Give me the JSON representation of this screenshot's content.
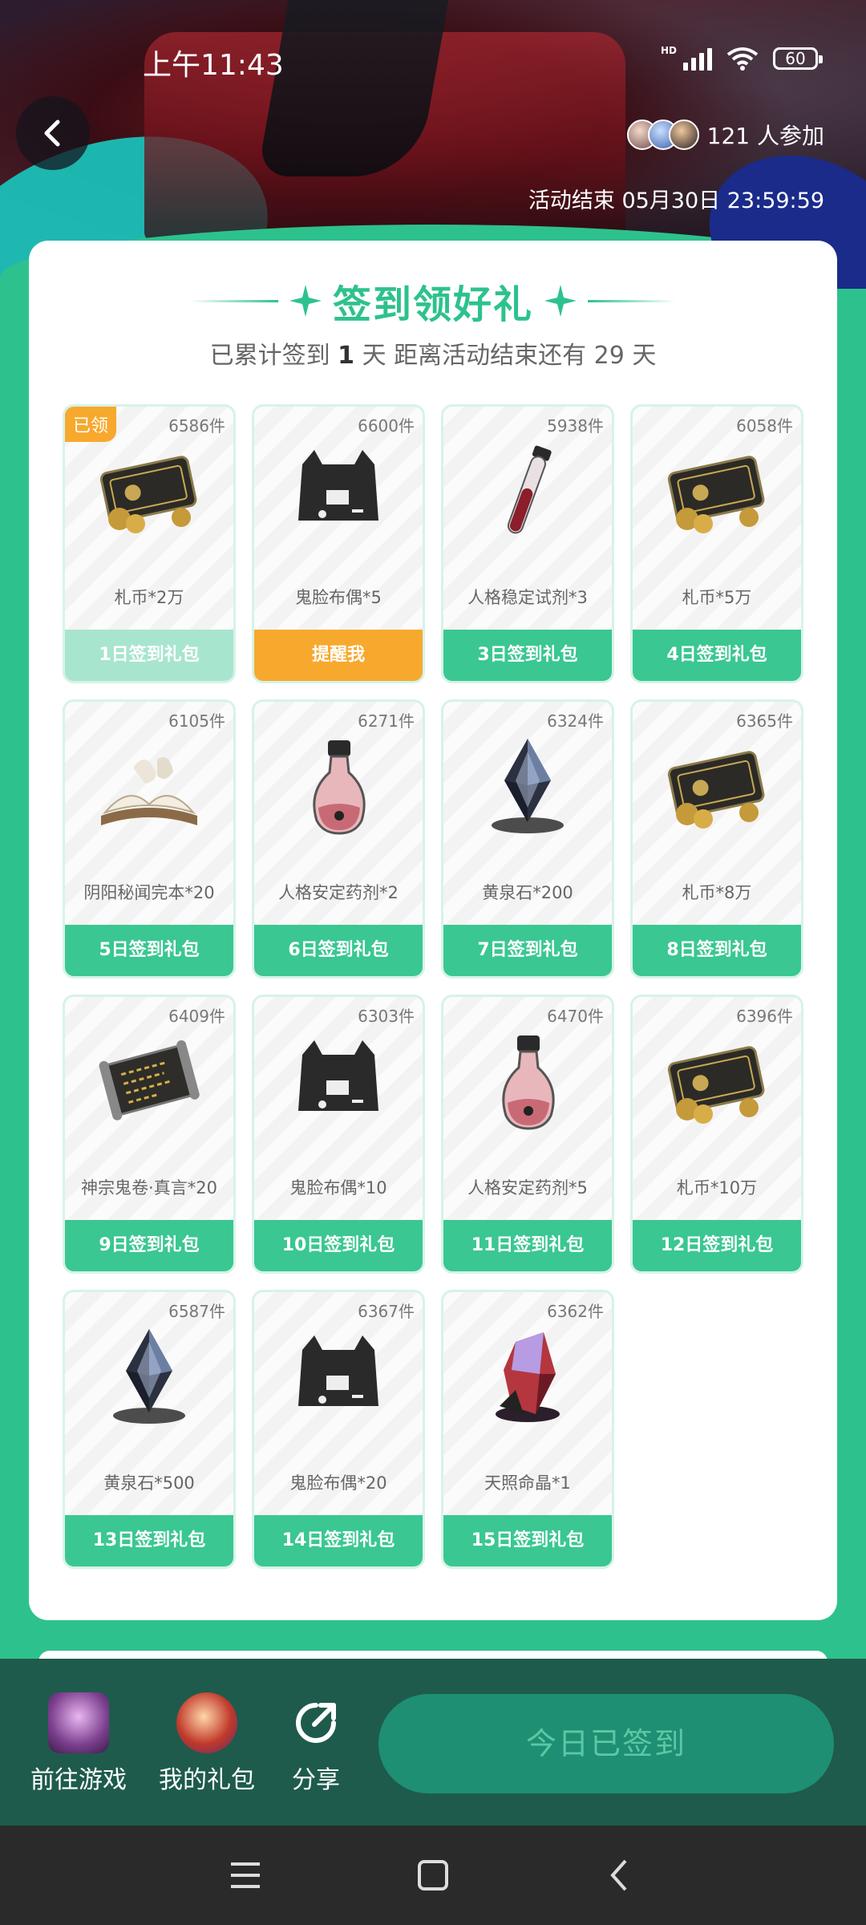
{
  "status": {
    "time": "上午11:43",
    "battery": "60",
    "network": "HD"
  },
  "header": {
    "participants_label": "121 人参加",
    "end_time": "活动结束 05月30日 23:59:59"
  },
  "card": {
    "title": "签到领好礼",
    "subtitle_prefix": "已累计签到",
    "days_signed": "1",
    "subtitle_mid": "天  距离活动结束还有",
    "days_left": "29",
    "subtitle_suffix": "天"
  },
  "rewards": [
    {
      "stock": "6586件",
      "name": "札币*2万",
      "button": "1日签到礼包",
      "state": "claimed",
      "tag": "已领",
      "icon": "coin-card-icon"
    },
    {
      "stock": "6600件",
      "name": "鬼脸布偶*5",
      "button": "提醒我",
      "state": "remind",
      "icon": "ghost-doll-icon"
    },
    {
      "stock": "5938件",
      "name": "人格稳定试剂*3",
      "button": "3日签到礼包",
      "state": "normal",
      "icon": "test-tube-icon"
    },
    {
      "stock": "6058件",
      "name": "札币*5万",
      "button": "4日签到礼包",
      "state": "normal",
      "icon": "coin-card-icon"
    },
    {
      "stock": "6105件",
      "name": "阴阳秘闻完本*20",
      "button": "5日签到礼包",
      "state": "normal",
      "icon": "book-icon"
    },
    {
      "stock": "6271件",
      "name": "人格安定药剂*2",
      "button": "6日签到礼包",
      "state": "normal",
      "icon": "potion-flask-icon"
    },
    {
      "stock": "6324件",
      "name": "黄泉石*200",
      "button": "7日签到礼包",
      "state": "normal",
      "icon": "crystal-icon"
    },
    {
      "stock": "6365件",
      "name": "札币*8万",
      "button": "8日签到礼包",
      "state": "normal",
      "icon": "coin-card-icon"
    },
    {
      "stock": "6409件",
      "name": "神宗鬼卷·真言*20",
      "button": "9日签到礼包",
      "state": "normal",
      "icon": "scroll-icon"
    },
    {
      "stock": "6303件",
      "name": "鬼脸布偶*10",
      "button": "10日签到礼包",
      "state": "normal",
      "icon": "ghost-doll-icon"
    },
    {
      "stock": "6470件",
      "name": "人格安定药剂*5",
      "button": "11日签到礼包",
      "state": "normal",
      "icon": "potion-flask-icon"
    },
    {
      "stock": "6396件",
      "name": "札币*10万",
      "button": "12日签到礼包",
      "state": "normal",
      "icon": "coin-card-icon"
    },
    {
      "stock": "6587件",
      "name": "黄泉石*500",
      "button": "13日签到礼包",
      "state": "normal",
      "icon": "crystal-icon"
    },
    {
      "stock": "6367件",
      "name": "鬼脸布偶*20",
      "button": "14日签到礼包",
      "state": "normal",
      "icon": "ghost-doll-icon"
    },
    {
      "stock": "6362件",
      "name": "天照命晶*1",
      "button": "15日签到礼包",
      "state": "normal",
      "icon": "purple-crystal-icon"
    }
  ],
  "bottom": {
    "go_game": "前往游戏",
    "my_gifts": "我的礼包",
    "share": "分享",
    "signed_today": "今日已签到"
  },
  "colors": {
    "accent": "#2dc28d",
    "orange": "#f7a92e",
    "bottom_bar": "#1e5b4c"
  }
}
